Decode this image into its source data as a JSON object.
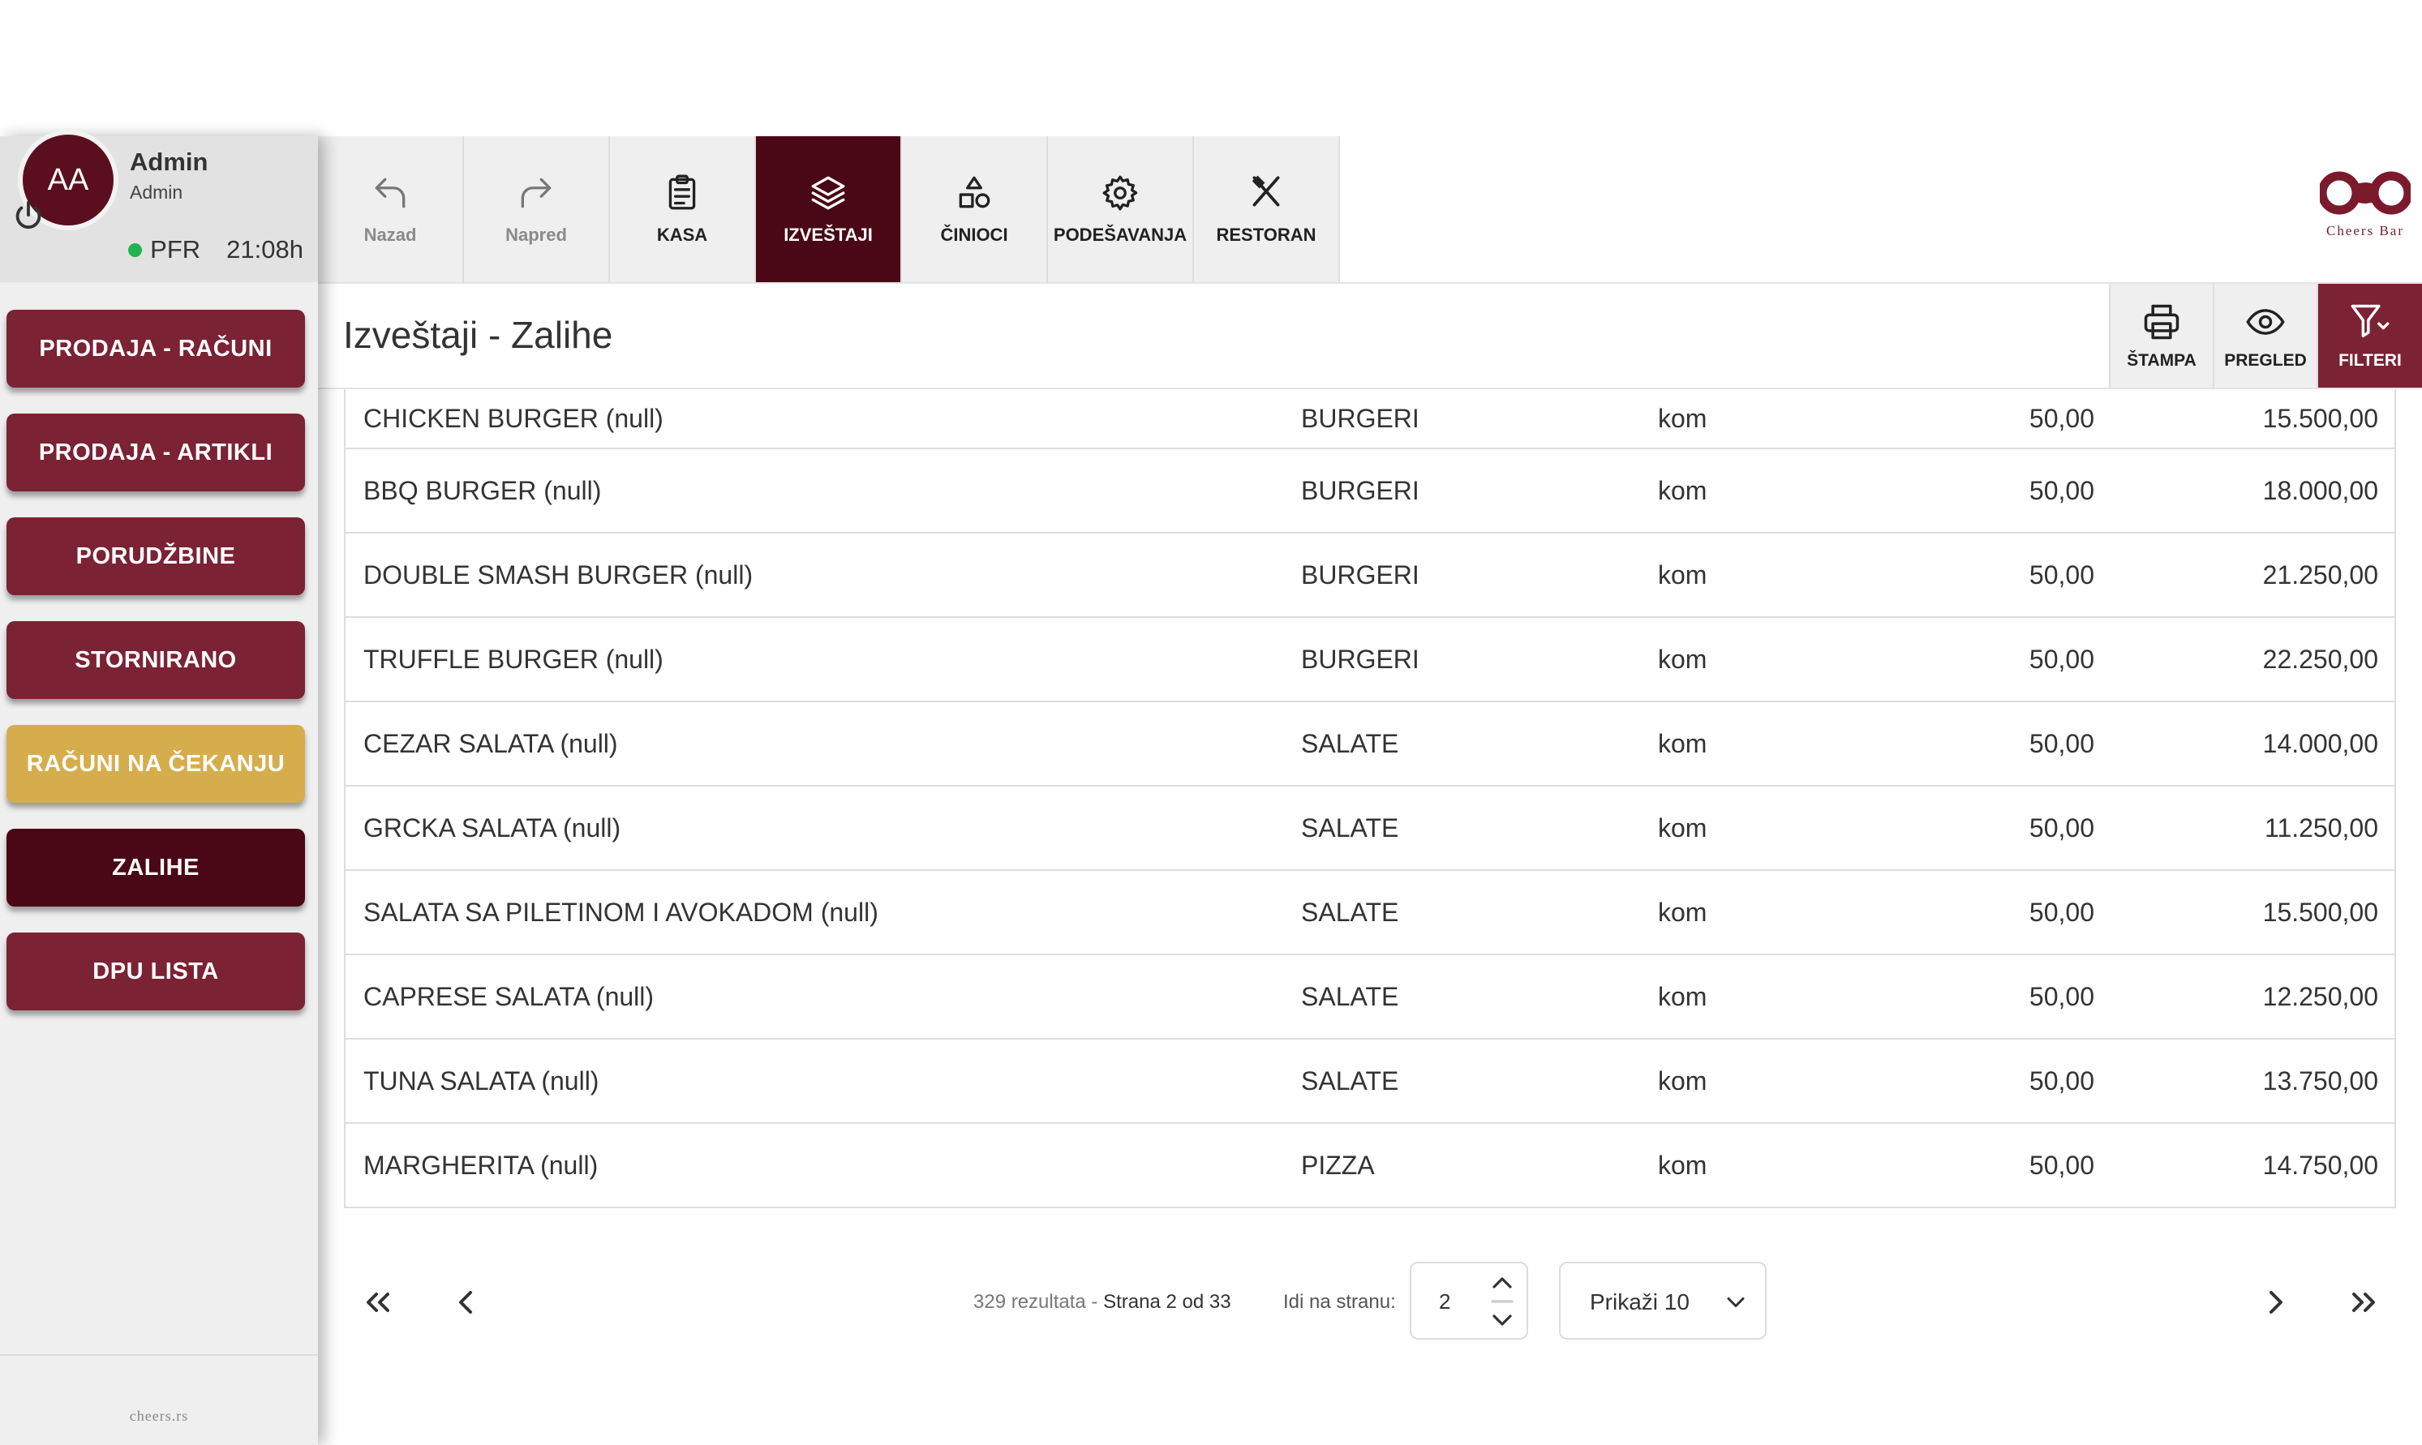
{
  "user": {
    "initials": "AA",
    "name": "Admin",
    "role": "Admin",
    "status_label": "PFR",
    "time": "21:08h"
  },
  "sidebar": {
    "items": [
      {
        "label": "PRODAJA - RAČUNI",
        "state": "normal"
      },
      {
        "label": "PRODAJA - ARTIKLI",
        "state": "normal"
      },
      {
        "label": "PORUDŽBINE",
        "state": "normal"
      },
      {
        "label": "STORNIRANO",
        "state": "normal"
      },
      {
        "label": "RAČUNI NA ČEKANJU",
        "state": "pending"
      },
      {
        "label": "ZALIHE",
        "state": "active"
      },
      {
        "label": "DPU LISTA",
        "state": "normal"
      }
    ],
    "footer": "cheers.rs"
  },
  "toolbar": {
    "back": "Nazad",
    "forward": "Napred",
    "items": [
      {
        "label": "KASA",
        "icon": "clipboard-icon"
      },
      {
        "label": "IZVEŠTAJI",
        "icon": "layers-icon",
        "active": true
      },
      {
        "label": "ČINIOCI",
        "icon": "shapes-icon"
      },
      {
        "label": "PODEŠAVANJA",
        "icon": "gear-icon"
      },
      {
        "label": "RESTORAN",
        "icon": "fork-knife-icon"
      }
    ]
  },
  "brand": {
    "name": "Cheers Bar"
  },
  "page": {
    "title": "Izveštaji - Zalihe",
    "actions": {
      "print": "ŠTAMPA",
      "preview": "PREGLED",
      "filters": "FILTERI"
    }
  },
  "table": {
    "rows": [
      {
        "name": "CHICKEN BURGER (null)",
        "category": "BURGERI",
        "unit": "kom",
        "qty": "50,00",
        "value": "15.500,00"
      },
      {
        "name": "BBQ BURGER (null)",
        "category": "BURGERI",
        "unit": "kom",
        "qty": "50,00",
        "value": "18.000,00"
      },
      {
        "name": "DOUBLE SMASH BURGER (null)",
        "category": "BURGERI",
        "unit": "kom",
        "qty": "50,00",
        "value": "21.250,00"
      },
      {
        "name": "TRUFFLE BURGER (null)",
        "category": "BURGERI",
        "unit": "kom",
        "qty": "50,00",
        "value": "22.250,00"
      },
      {
        "name": "CEZAR SALATA (null)",
        "category": "SALATE",
        "unit": "kom",
        "qty": "50,00",
        "value": "14.000,00"
      },
      {
        "name": "GRCKA SALATA (null)",
        "category": "SALATE",
        "unit": "kom",
        "qty": "50,00",
        "value": "11.250,00"
      },
      {
        "name": "SALATA SA PILETINOM I AVOKADOM (null)",
        "category": "SALATE",
        "unit": "kom",
        "qty": "50,00",
        "value": "15.500,00"
      },
      {
        "name": "CAPRESE SALATA (null)",
        "category": "SALATE",
        "unit": "kom",
        "qty": "50,00",
        "value": "12.250,00"
      },
      {
        "name": "TUNA SALATA (null)",
        "category": "SALATE",
        "unit": "kom",
        "qty": "50,00",
        "value": "13.750,00"
      },
      {
        "name": "MARGHERITA (null)",
        "category": "PIZZA",
        "unit": "kom",
        "qty": "50,00",
        "value": "14.750,00"
      }
    ]
  },
  "pagination": {
    "results": "329 rezultata - ",
    "page_info": "Strana 2 od 33",
    "goto_label": "Idi na stranu:",
    "goto_value": "2",
    "page_size": "Prikaži 10"
  },
  "colors": {
    "brand": "#7b2234",
    "active": "#4a0715",
    "pending": "#d6ad4d",
    "status_online": "#21b34d"
  }
}
